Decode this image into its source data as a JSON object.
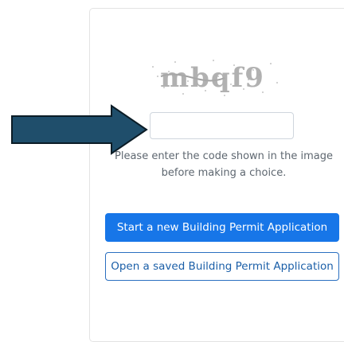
{
  "captcha": {
    "code_text": "mbqf9"
  },
  "code_input": {
    "value": "",
    "placeholder": ""
  },
  "instruction_text": "Please enter the code shown in the image before making a choice.",
  "buttons": {
    "start_new_label": "Start a new Building Permit Application",
    "open_saved_label": "Open a saved Building Permit Application"
  },
  "colors": {
    "primary": "#1776e8",
    "outline_border": "#2a6fc0",
    "arrow_fill": "#1f4e6b"
  }
}
